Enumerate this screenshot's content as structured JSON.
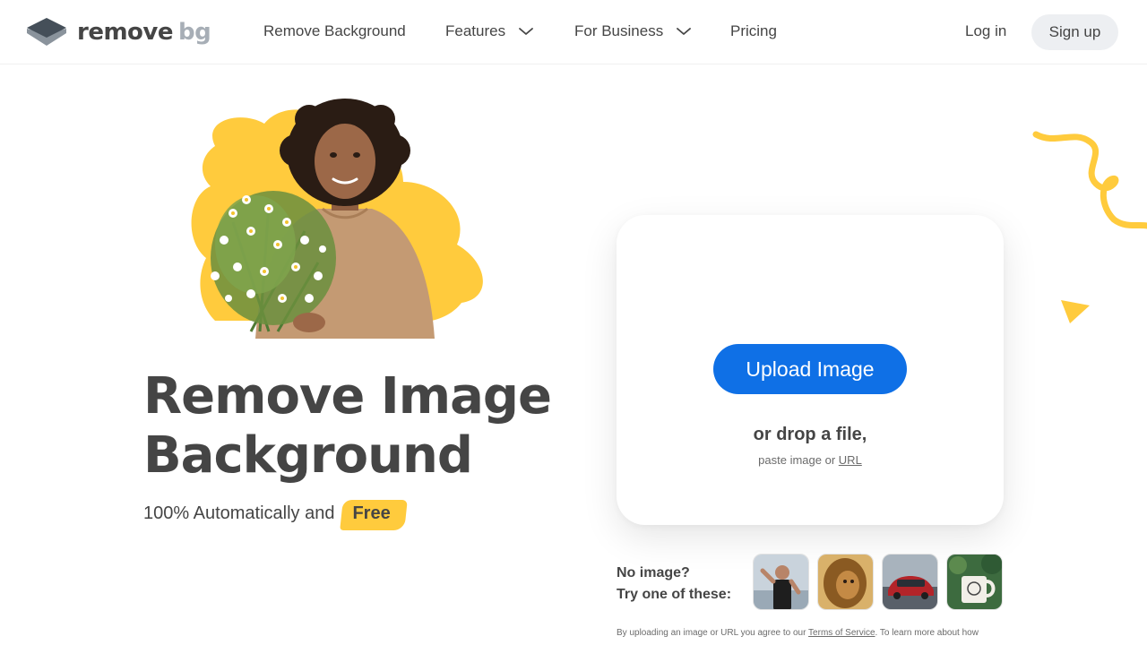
{
  "header": {
    "logo": {
      "word_main": "remove",
      "word_accent": "bg"
    },
    "nav": [
      {
        "label": "Remove Background",
        "has_dropdown": false
      },
      {
        "label": "Features",
        "has_dropdown": true
      },
      {
        "label": "For Business",
        "has_dropdown": true
      },
      {
        "label": "Pricing",
        "has_dropdown": false
      }
    ],
    "login_label": "Log in",
    "signup_label": "Sign up"
  },
  "hero": {
    "title_line1": "Remove Image",
    "title_line2": "Background",
    "subtitle": "100% Automatically and",
    "badge": "Free"
  },
  "upload": {
    "button_label": "Upload Image",
    "drop_text": "or drop a file,",
    "paste_prefix": "paste image or",
    "paste_link": "URL"
  },
  "samples": {
    "line1": "No image?",
    "line2": "Try one of these:",
    "thumbnails": [
      "woman-athlete",
      "lion",
      "red-car",
      "coffee-mug"
    ]
  },
  "legal": {
    "prefix": "By uploading an image or URL you agree to our",
    "tos_link": "Terms of Service",
    "suffix": ". To learn more about how"
  },
  "colors": {
    "primary": "#0f70e6",
    "accent_yellow": "#ffcb3d",
    "text": "#454545",
    "logo_accent": "#a7aeb6",
    "signup_bg": "#edeff2"
  }
}
